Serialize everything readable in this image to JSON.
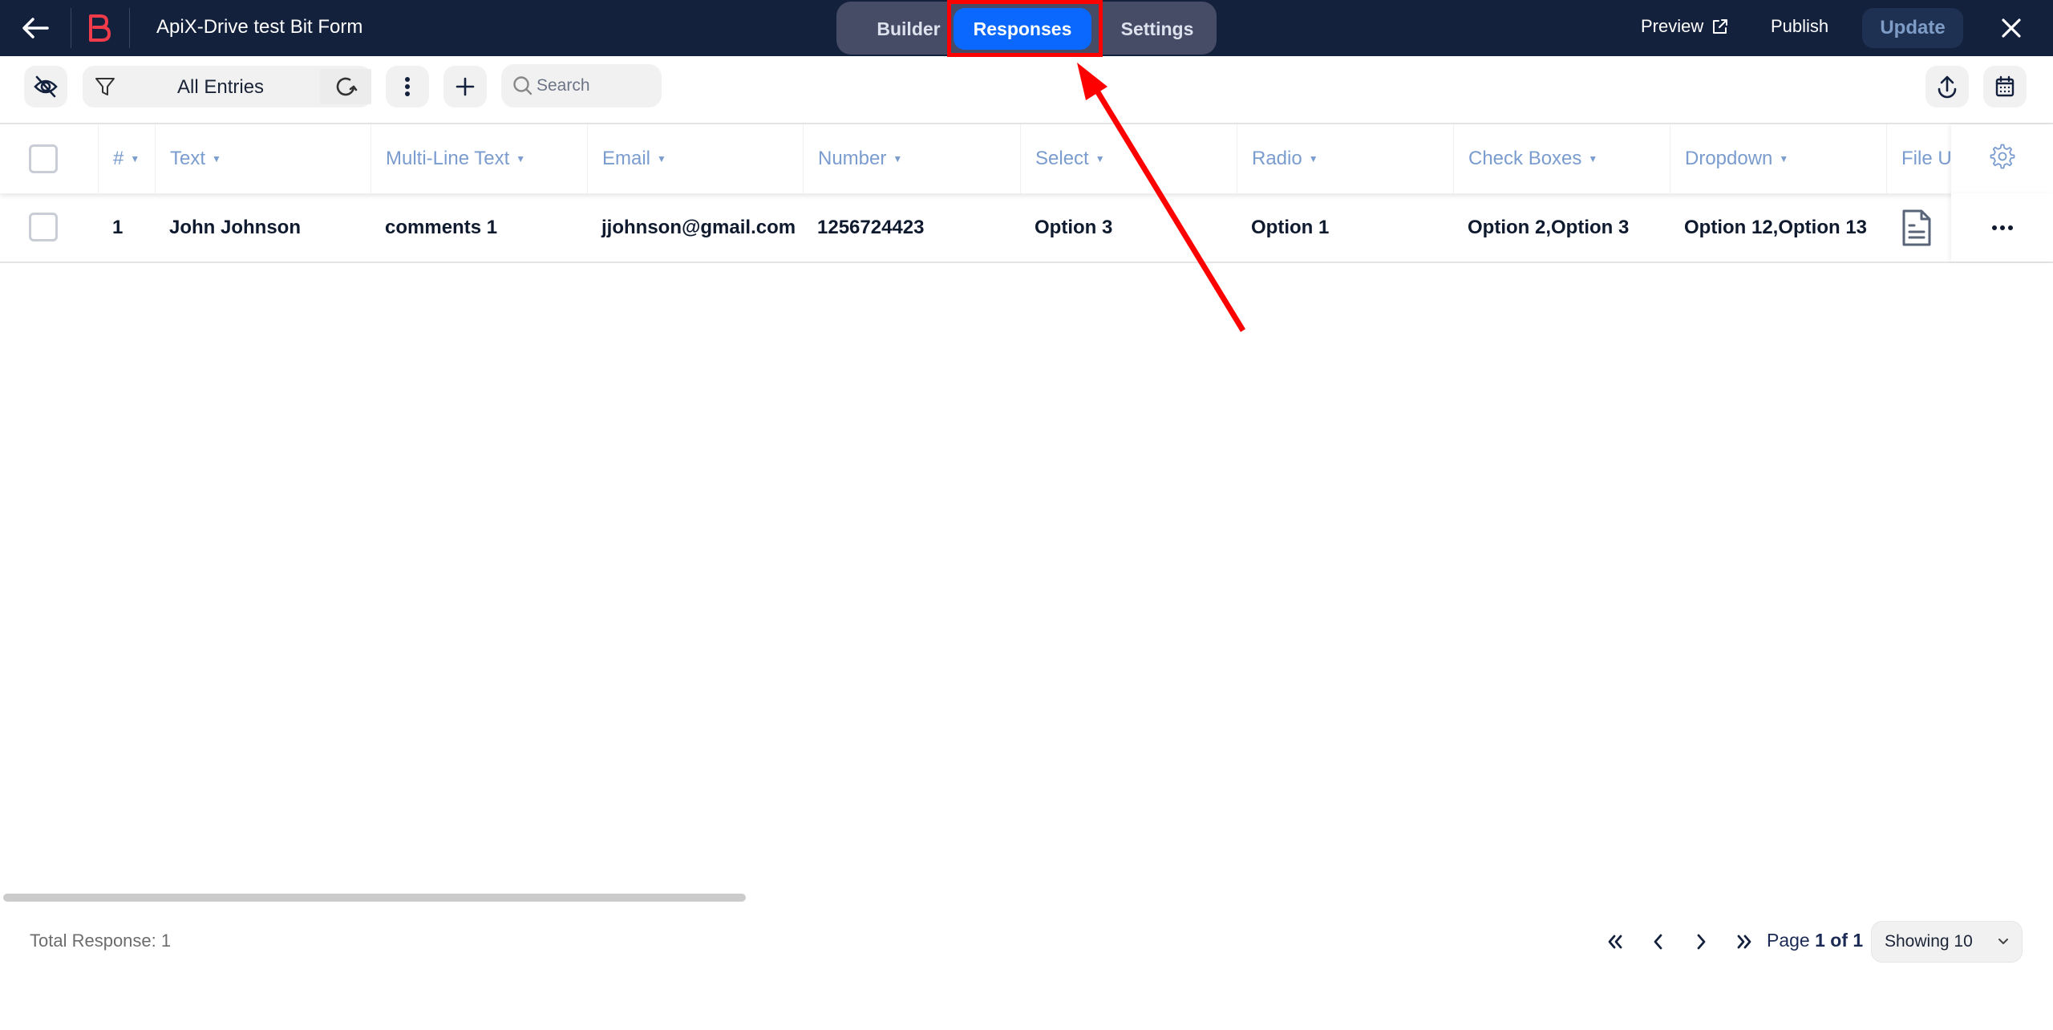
{
  "header": {
    "title": "ApiX-Drive test Bit Form",
    "tabs": [
      {
        "label": "Builder",
        "active": false
      },
      {
        "label": "Responses",
        "active": true
      },
      {
        "label": "Settings",
        "active": false
      }
    ],
    "preview_label": "Preview",
    "publish_label": "Publish",
    "update_label": "Update",
    "brand_color": "#ef3b4a",
    "bar_color": "#14213d",
    "active_tab_color": "#0a68ff"
  },
  "toolbar": {
    "filter_label": "All Entries",
    "search_placeholder": "Search"
  },
  "table": {
    "columns": [
      {
        "label": "#"
      },
      {
        "label": "Text"
      },
      {
        "label": "Multi-Line Text"
      },
      {
        "label": "Email"
      },
      {
        "label": "Number"
      },
      {
        "label": "Select"
      },
      {
        "label": "Radio"
      },
      {
        "label": "Check Boxes"
      },
      {
        "label": "Dropdown"
      },
      {
        "label": "File U"
      }
    ],
    "rows": [
      {
        "index": "1",
        "text": "John Johnson",
        "multiline": "comments 1",
        "email": "jjohnson@gmail.com",
        "number": "1256724423",
        "select": "Option 3",
        "radio": "Option 1",
        "checkboxes": "Option 2,Option 3",
        "dropdown": "Option 12,Option 13",
        "file": "file-icon"
      }
    ]
  },
  "footer": {
    "total_label": "Total Response: 1",
    "page_prefix": "Page",
    "page_value": "1 of 1",
    "showing_label": "Showing 10"
  },
  "annotation": {
    "color": "#ff0000",
    "target": "Responses"
  }
}
